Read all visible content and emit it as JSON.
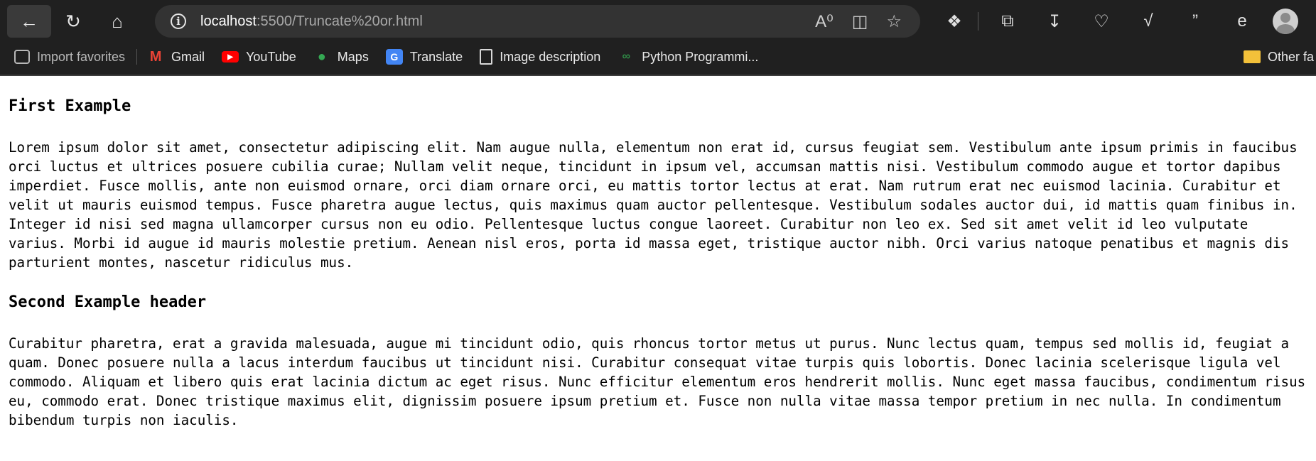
{
  "browser": {
    "url_host": "localhost",
    "url_path": ":5500/Truncate%20or.html",
    "bookmarks": [
      {
        "label": "Import favorites",
        "icon": "import-icon"
      },
      {
        "label": "Gmail",
        "icon": "gmail-icon"
      },
      {
        "label": "YouTube",
        "icon": "youtube-icon"
      },
      {
        "label": "Maps",
        "icon": "maps-icon"
      },
      {
        "label": "Translate",
        "icon": "translate-icon"
      },
      {
        "label": "Image description",
        "icon": "document-icon"
      },
      {
        "label": "Python Programmi...",
        "icon": "python-icon"
      }
    ],
    "other_favorites": "Other fa"
  },
  "page": {
    "heading1": "First Example",
    "paragraph1": "Lorem ipsum dolor sit amet, consectetur adipiscing elit. Nam augue nulla, elementum non erat id, cursus feugiat sem. Vestibulum ante ipsum primis in faucibus orci luctus et ultrices posuere cubilia curae; Nullam velit neque, tincidunt in ipsum vel, accumsan mattis nisi. Vestibulum commodo augue et tortor dapibus imperdiet. Fusce mollis, ante non euismod ornare, orci diam ornare orci, eu mattis tortor lectus at erat. Nam rutrum erat nec euismod lacinia. Curabitur et velit ut mauris euismod tempus. Fusce pharetra augue lectus, quis maximus quam auctor pellentesque. Vestibulum sodales auctor dui, id mattis quam finibus in. Integer id nisi sed magna ullamcorper cursus non eu odio. Pellentesque luctus congue laoreet. Curabitur non leo ex. Sed sit amet velit id leo vulputate varius. Morbi id augue id mauris molestie pretium. Aenean nisl eros, porta id massa eget, tristique auctor nibh. Orci varius natoque penatibus et magnis dis parturient montes, nascetur ridiculus mus.",
    "heading2": "Second Example header",
    "paragraph2": "Curabitur pharetra, erat a gravida malesuada, augue mi tincidunt odio, quis rhoncus tortor metus ut purus. Nunc lectus quam, tempus sed mollis id, feugiat a quam. Donec posuere nulla a lacus interdum faucibus ut tincidunt nisi. Curabitur consequat vitae turpis quis lobortis. Donec lacinia scelerisque ligula vel commodo. Aliquam et libero quis erat lacinia dictum ac eget risus. Nunc efficitur elementum eros hendrerit mollis. Nunc eget massa faucibus, condimentum risus eu, commodo erat. Donec tristique maximus elit, dignissim posuere ipsum pretium et. Fusce non nulla vitae massa tempor pretium in nec nulla. In condimentum bibendum turpis non iaculis."
  },
  "colors": {
    "chrome_bg": "#202020",
    "address_bg": "#333333",
    "page_bg": "#ffffff"
  }
}
